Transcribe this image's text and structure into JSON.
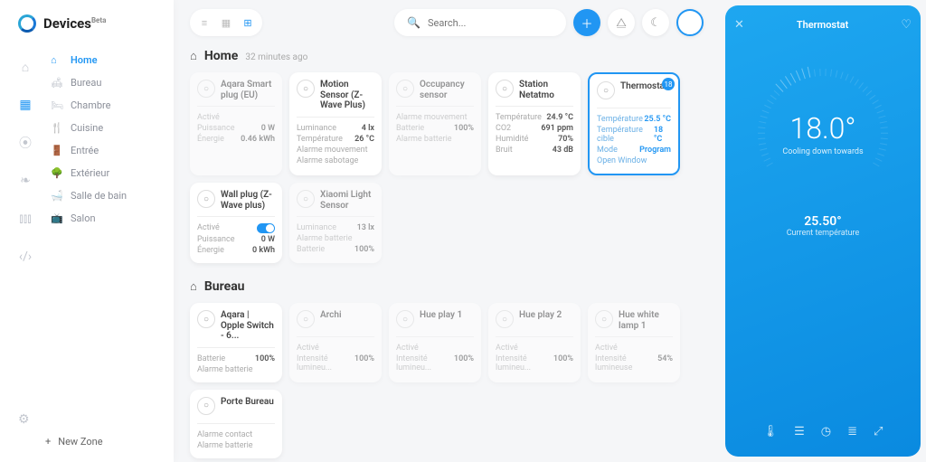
{
  "brand": {
    "title": "Devices",
    "badge": "Beta"
  },
  "sidebar": {
    "zones": [
      {
        "label": "Home",
        "icon": "home",
        "active": true
      },
      {
        "label": "Bureau",
        "icon": "couch"
      },
      {
        "label": "Chambre",
        "icon": "bed"
      },
      {
        "label": "Cuisine",
        "icon": "utensils"
      },
      {
        "label": "Entrée",
        "icon": "door"
      },
      {
        "label": "Extérieur",
        "icon": "tree"
      },
      {
        "label": "Salle de bain",
        "icon": "bath"
      },
      {
        "label": "Salon",
        "icon": "tv"
      }
    ],
    "newZone": "New Zone"
  },
  "topbar": {
    "searchPlaceholder": "Search..."
  },
  "sections": [
    {
      "name": "Home",
      "sub": "32 minutes ago",
      "cards": [
        {
          "title": "Aqara Smart plug (EU)",
          "faded": true,
          "rows": [
            [
              "Activé",
              ""
            ],
            [
              "Puissance",
              "0 W"
            ],
            [
              "Énergie",
              "0.46 kWh"
            ]
          ]
        },
        {
          "title": "Motion Sensor (Z-Wave Plus)",
          "rows": [
            [
              "Luminance",
              "4 lx"
            ],
            [
              "Température",
              "26 °C"
            ],
            [
              "Alarme mouvement",
              ""
            ],
            [
              "Alarme sabotage",
              ""
            ]
          ]
        },
        {
          "title": "Occupancy sensor",
          "faded": true,
          "rows": [
            [
              "Alarme mouvement",
              ""
            ],
            [
              "Batterie",
              "100%"
            ],
            [
              "Alarme batterie",
              ""
            ]
          ]
        },
        {
          "title": "Station Netatmo",
          "rows": [
            [
              "Température",
              "24.9 °C"
            ],
            [
              "CO2",
              "691 ppm"
            ],
            [
              "Humidité",
              "70%"
            ],
            [
              "Bruit",
              "43 dB"
            ]
          ]
        },
        {
          "title": "Thermostat",
          "selected": true,
          "badge": "18",
          "rows": [
            [
              "Température",
              "25.5 °C"
            ],
            [
              "Température cible",
              "18 °C"
            ],
            [
              "Mode",
              "Program"
            ],
            [
              "Open Window",
              ""
            ]
          ]
        },
        {
          "title": "Wall plug (Z-Wave plus)",
          "rows": [
            [
              "Activé",
              "toggle"
            ],
            [
              "Puissance",
              "0 W"
            ],
            [
              "Énergie",
              "0 kWh"
            ]
          ]
        },
        {
          "title": "Xiaomi Light Sensor",
          "faded": true,
          "rows": [
            [
              "Luminance",
              "13 lx"
            ],
            [
              "Alarme batterie",
              ""
            ],
            [
              "Batterie",
              "100%"
            ]
          ]
        }
      ]
    },
    {
      "name": "Bureau",
      "sub": "",
      "cards": [
        {
          "title": "Aqara | Opple Switch - 6...",
          "rows": [
            [
              "Batterie",
              "100%"
            ],
            [
              "Alarme batterie",
              ""
            ]
          ]
        },
        {
          "title": "Archi",
          "faded": true,
          "rows": [
            [
              "Activé",
              ""
            ],
            [
              "Intensité lumineu...",
              "100%"
            ]
          ]
        },
        {
          "title": "Hue play 1",
          "faded": true,
          "rows": [
            [
              "Activé",
              ""
            ],
            [
              "Intensité lumineu...",
              "100%"
            ]
          ]
        },
        {
          "title": "Hue play 2",
          "faded": true,
          "rows": [
            [
              "Activé",
              ""
            ],
            [
              "Intensité lumineu...",
              "100%"
            ]
          ]
        },
        {
          "title": "Hue white lamp 1",
          "faded": true,
          "rows": [
            [
              "Activé",
              ""
            ],
            [
              "Intensité lumineuse",
              "54%"
            ]
          ]
        },
        {
          "title": "Porte Bureau",
          "rows": [
            [
              "Alarme contact",
              ""
            ],
            [
              "Alarme batterie",
              ""
            ]
          ]
        }
      ]
    }
  ],
  "panel": {
    "title": "Thermostat",
    "mainTemp": "18.0°",
    "mainLabel": "Cooling down towards",
    "currentTemp": "25.50°",
    "currentLabel": "Current température"
  }
}
